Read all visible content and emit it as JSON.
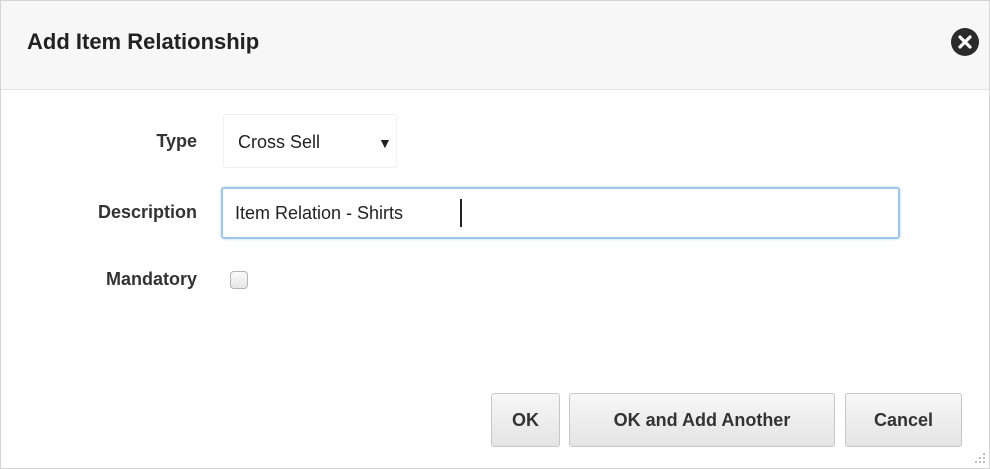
{
  "dialog": {
    "title": "Add Item Relationship",
    "close_icon": "close-circle-icon"
  },
  "form": {
    "type": {
      "label": "Type",
      "value": "Cross Sell",
      "arrow": "▼"
    },
    "description": {
      "label": "Description",
      "value": "Item Relation - Shirts"
    },
    "mandatory": {
      "label": "Mandatory",
      "checked": false
    }
  },
  "buttons": {
    "ok": "OK",
    "ok_add_another": "OK and Add Another",
    "cancel": "Cancel"
  },
  "colors": {
    "focus_border": "#9fc6ea",
    "title_bg": "#f7f7f7"
  }
}
